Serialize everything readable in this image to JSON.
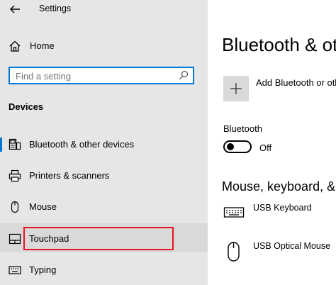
{
  "window": {
    "title": "Settings"
  },
  "sidebar": {
    "home_label": "Home",
    "search_placeholder": "Find a setting",
    "section_title": "Devices",
    "items": [
      {
        "label": "Bluetooth & other devices",
        "icon": "bluetooth-devices-icon"
      },
      {
        "label": "Printers & scanners",
        "icon": "printer-icon"
      },
      {
        "label": "Mouse",
        "icon": "mouse-icon"
      },
      {
        "label": "Touchpad",
        "icon": "touchpad-icon",
        "selected": true
      },
      {
        "label": "Typing",
        "icon": "keyboard-icon"
      }
    ]
  },
  "main": {
    "heading": "Bluetooth & other devices",
    "add_device_label": "Add Bluetooth or other device",
    "bluetooth_label": "Bluetooth",
    "bluetooth_state": "Off",
    "subheading": "Mouse, keyboard, & pen",
    "devices": [
      {
        "label": "USB Keyboard",
        "icon": "keyboard-icon"
      },
      {
        "label": "USB Optical Mouse",
        "icon": "mouse-icon"
      }
    ]
  },
  "colors": {
    "accent": "#0078d7",
    "highlight_border": "#e81123",
    "sidebar_bg": "#e6e6e6",
    "selected_bg": "#d9d9d9"
  }
}
